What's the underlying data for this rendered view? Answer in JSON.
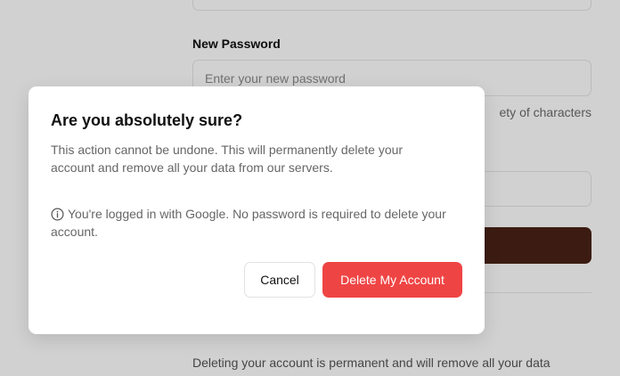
{
  "background": {
    "new_password_label": "New Password",
    "new_password_placeholder": "Enter your new password",
    "password_hint_fragment": "ety of characters",
    "danger_zone_description": "Deleting your account is permanent and will remove all your data"
  },
  "dialog": {
    "title": "Are you absolutely sure?",
    "description": "This action cannot be undone. This will permanently delete your account and remove all your data from our servers.",
    "note": "You're logged in with Google. No password is required to delete your account.",
    "note_icon": "info-icon",
    "cancel_label": "Cancel",
    "delete_label": "Delete My Account"
  },
  "colors": {
    "delete_button": "#ef4444",
    "dark_button": "#4a2316"
  }
}
